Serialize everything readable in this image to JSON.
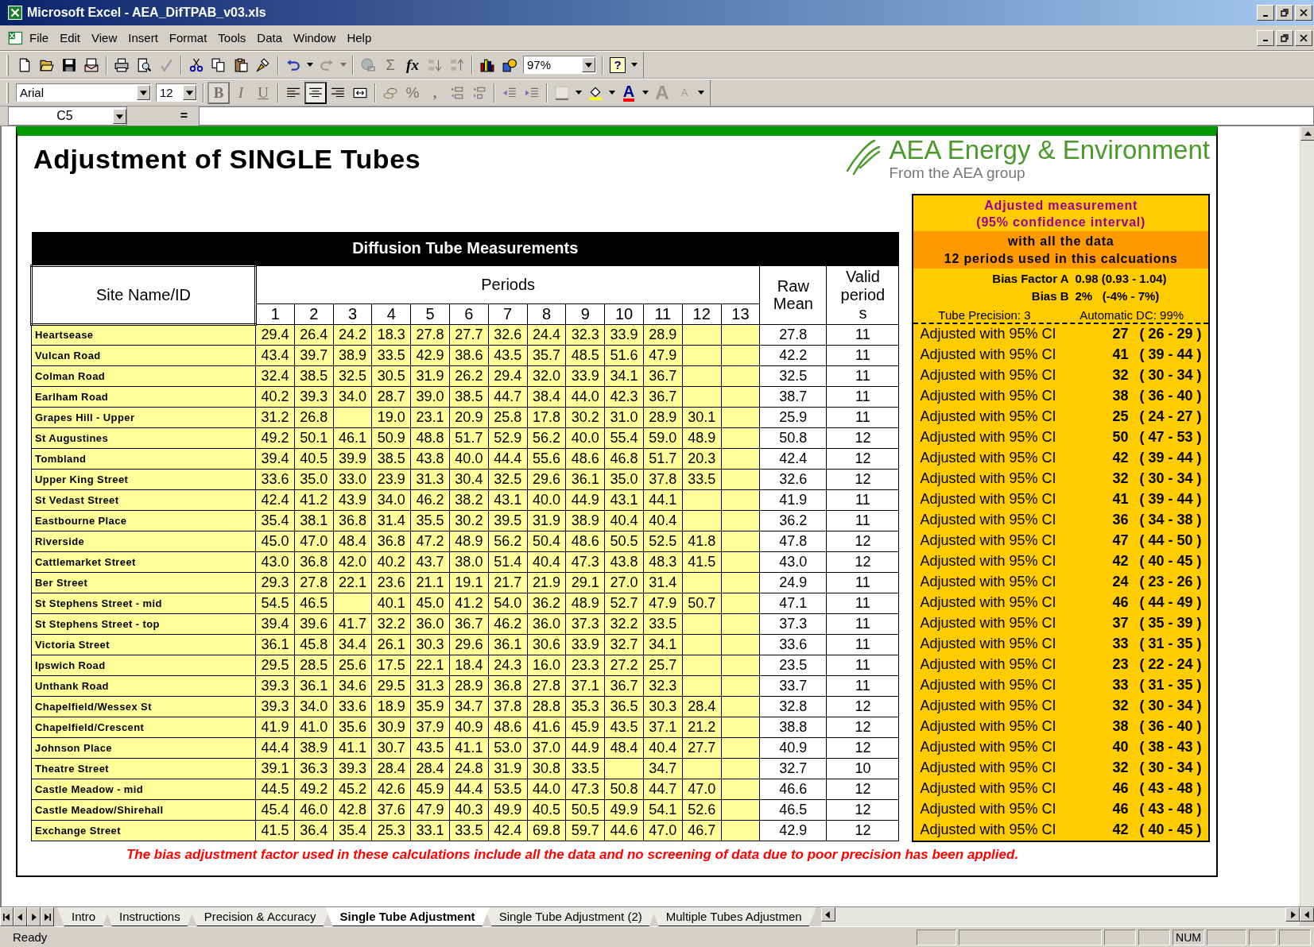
{
  "window": {
    "title": "Microsoft Excel - AEA_DifTPAB_v03.xls"
  },
  "menu": [
    "File",
    "Edit",
    "View",
    "Insert",
    "Format",
    "Tools",
    "Data",
    "Window",
    "Help"
  ],
  "standard_toolbar": [
    {
      "kind": "new",
      "disabled": false
    },
    {
      "kind": "open",
      "disabled": false
    },
    {
      "kind": "save",
      "disabled": false
    },
    {
      "kind": "mail",
      "disabled": false
    },
    {
      "kind": "separator"
    },
    {
      "kind": "print",
      "disabled": false
    },
    {
      "kind": "preview",
      "disabled": false
    },
    {
      "kind": "spelling",
      "disabled": true
    },
    {
      "kind": "separator"
    },
    {
      "kind": "cut",
      "disabled": false
    },
    {
      "kind": "copy",
      "disabled": false
    },
    {
      "kind": "paste",
      "disabled": false
    },
    {
      "kind": "painter",
      "disabled": false
    },
    {
      "kind": "separator"
    },
    {
      "kind": "undo",
      "disabled": false
    },
    {
      "kind": "caret",
      "disabled": false
    },
    {
      "kind": "redo",
      "disabled": true
    },
    {
      "kind": "caret",
      "disabled": true
    },
    {
      "kind": "separator"
    },
    {
      "kind": "hyperlink",
      "disabled": true
    },
    {
      "kind": "plainglyph",
      "text": "Σ",
      "disabled": true
    },
    {
      "kind": "scriptglyph",
      "text": "fx",
      "disabled": false
    },
    {
      "kind": "sortasc",
      "disabled": true
    },
    {
      "kind": "sortdesc",
      "disabled": true
    },
    {
      "kind": "separator"
    },
    {
      "kind": "chart",
      "disabled": false
    },
    {
      "kind": "drawing",
      "disabled": false
    },
    {
      "kind": "zoombox",
      "value": "97%"
    },
    {
      "kind": "separator"
    },
    {
      "kind": "helpglyph",
      "text": "?",
      "disabled": false
    },
    {
      "kind": "options",
      "disabled": false
    }
  ],
  "formatting_toolbar": [
    {
      "kind": "fontbox",
      "value": "Arial"
    },
    {
      "kind": "sizebox",
      "value": "12"
    },
    {
      "kind": "separator"
    },
    {
      "kind": "boldglyph",
      "text": "B",
      "disabled": true,
      "pressed": true
    },
    {
      "kind": "italicglyph",
      "text": "I",
      "disabled": true,
      "pressed": false
    },
    {
      "kind": "underlineglyph",
      "text": "U",
      "disabled": true,
      "pressed": false
    },
    {
      "kind": "separator"
    },
    {
      "kind": "alignleft",
      "disabled": false,
      "pressed": false
    },
    {
      "kind": "aligncenter",
      "disabled": false,
      "pressed": true
    },
    {
      "kind": "alignright",
      "disabled": false,
      "pressed": false
    },
    {
      "kind": "merge",
      "disabled": false,
      "pressed": false
    },
    {
      "kind": "separator"
    },
    {
      "kind": "currency",
      "disabled": true,
      "pressed": false
    },
    {
      "kind": "plainglyph",
      "text": "%",
      "disabled": true,
      "pressed": false
    },
    {
      "kind": "boldglyph",
      "text": ",",
      "disabled": true,
      "pressed": false
    },
    {
      "kind": "incdecimal",
      "disabled": true,
      "pressed": false
    },
    {
      "kind": "decdecimal",
      "disabled": true,
      "pressed": false
    },
    {
      "kind": "separator"
    },
    {
      "kind": "outdent",
      "disabled": true,
      "pressed": false
    },
    {
      "kind": "indent",
      "disabled": true,
      "pressed": false
    },
    {
      "kind": "separator"
    },
    {
      "kind": "borders",
      "disabled": true,
      "pressed": false
    },
    {
      "kind": "caret",
      "disabled": false,
      "pressed": false
    },
    {
      "kind": "fill",
      "disabled": false,
      "pressed": false
    },
    {
      "kind": "caret",
      "disabled": false,
      "pressed": false
    },
    {
      "kind": "colorglyph",
      "text": "A",
      "disabled": false,
      "pressed": false
    },
    {
      "kind": "caret",
      "disabled": false,
      "pressed": false
    },
    {
      "kind": "growglyph",
      "text": "A",
      "disabled": true,
      "pressed": false
    },
    {
      "kind": "shrinkglyph",
      "text": "A",
      "disabled": true,
      "pressed": false
    },
    {
      "kind": "options",
      "disabled": false,
      "pressed": false
    }
  ],
  "formula_bar": {
    "name_box": "C5",
    "equals": "="
  },
  "sheet": {
    "title": "Adjustment of SINGLE Tubes",
    "logo": {
      "name": "AEA Energy & Environment",
      "tagline": "From the AEA group"
    },
    "table": {
      "caption": "Diffusion Tube Measurements",
      "columns": {
        "site": "Site Name/ID",
        "periods": "Periods",
        "raw_mean": "Raw Mean",
        "valid_periods": "Valid periods"
      },
      "period_numbers": [
        "1",
        "2",
        "3",
        "4",
        "5",
        "6",
        "7",
        "8",
        "9",
        "10",
        "11",
        "12",
        "13"
      ],
      "rows": [
        {
          "site": "Heartsease",
          "values": {
            "p1": "29.4",
            "p2": "26.4",
            "p3": "24.2",
            "p4": "18.3",
            "p5": "27.8",
            "p6": "27.7",
            "p7": "32.6",
            "p8": "24.4",
            "p9": "32.3",
            "p10": "33.9",
            "p11": "28.9"
          },
          "raw_mean": "27.8",
          "valid": "11",
          "adjusted": {
            "label": "Adjusted with 95% CI",
            "value": "27",
            "interval": "( 26 - 29 )"
          }
        },
        {
          "site": "Vulcan Road",
          "values": {
            "p1": "43.4",
            "p2": "39.7",
            "p3": "38.9",
            "p4": "33.5",
            "p5": "42.9",
            "p6": "38.6",
            "p7": "43.5",
            "p8": "35.7",
            "p9": "48.5",
            "p10": "51.6",
            "p11": "47.9"
          },
          "raw_mean": "42.2",
          "valid": "11",
          "adjusted": {
            "label": "Adjusted with 95% CI",
            "value": "41",
            "interval": "( 39 - 44 )"
          }
        },
        {
          "site": "Colman Road",
          "values": {
            "p1": "32.4",
            "p2": "38.5",
            "p3": "32.5",
            "p4": "30.5",
            "p5": "31.9",
            "p6": "26.2",
            "p7": "29.4",
            "p8": "32.0",
            "p9": "33.9",
            "p10": "34.1",
            "p11": "36.7"
          },
          "raw_mean": "32.5",
          "valid": "11",
          "adjusted": {
            "label": "Adjusted with 95% CI",
            "value": "32",
            "interval": "( 30 - 34 )"
          }
        },
        {
          "site": "Earlham Road",
          "values": {
            "p1": "40.2",
            "p2": "39.3",
            "p3": "34.0",
            "p4": "28.7",
            "p5": "39.0",
            "p6": "38.5",
            "p7": "44.7",
            "p8": "38.4",
            "p9": "44.0",
            "p10": "42.3",
            "p11": "36.7"
          },
          "raw_mean": "38.7",
          "valid": "11",
          "adjusted": {
            "label": "Adjusted with 95% CI",
            "value": "38",
            "interval": "( 36 - 40 )"
          }
        },
        {
          "site": "Grapes Hill - Upper",
          "values": {
            "p1": "31.2",
            "p2": "26.8",
            "p4": "19.0",
            "p5": "23.1",
            "p6": "20.9",
            "p7": "25.8",
            "p8": "17.8",
            "p9": "30.2",
            "p10": "31.0",
            "p11": "28.9",
            "p12": "30.1"
          },
          "raw_mean": "25.9",
          "valid": "11",
          "adjusted": {
            "label": "Adjusted with 95% CI",
            "value": "25",
            "interval": "( 24 - 27 )"
          }
        },
        {
          "site": "St Augustines",
          "values": {
            "p1": "49.2",
            "p2": "50.1",
            "p3": "46.1",
            "p4": "50.9",
            "p5": "48.8",
            "p6": "51.7",
            "p7": "52.9",
            "p8": "56.2",
            "p9": "40.0",
            "p10": "55.4",
            "p11": "59.0",
            "p12": "48.9"
          },
          "raw_mean": "50.8",
          "valid": "12",
          "adjusted": {
            "label": "Adjusted with 95% CI",
            "value": "50",
            "interval": "( 47 - 53 )"
          }
        },
        {
          "site": "Tombland",
          "values": {
            "p1": "39.4",
            "p2": "40.5",
            "p3": "39.9",
            "p4": "38.5",
            "p5": "43.8",
            "p6": "40.0",
            "p7": "44.4",
            "p8": "55.6",
            "p9": "48.6",
            "p10": "46.8",
            "p11": "51.7",
            "p12": "20.3"
          },
          "raw_mean": "42.4",
          "valid": "12",
          "adjusted": {
            "label": "Adjusted with 95% CI",
            "value": "42",
            "interval": "( 39 - 44 )"
          }
        },
        {
          "site": "Upper King Street",
          "values": {
            "p1": "33.6",
            "p2": "35.0",
            "p3": "33.0",
            "p4": "23.9",
            "p5": "31.3",
            "p6": "30.4",
            "p7": "32.5",
            "p8": "29.6",
            "p9": "36.1",
            "p10": "35.0",
            "p11": "37.8",
            "p12": "33.5"
          },
          "raw_mean": "32.6",
          "valid": "12",
          "adjusted": {
            "label": "Adjusted with 95% CI",
            "value": "32",
            "interval": "( 30 - 34 )"
          }
        },
        {
          "site": "St Vedast Street",
          "values": {
            "p1": "42.4",
            "p2": "41.2",
            "p3": "43.9",
            "p4": "34.0",
            "p5": "46.2",
            "p6": "38.2",
            "p7": "43.1",
            "p8": "40.0",
            "p9": "44.9",
            "p10": "43.1",
            "p11": "44.1"
          },
          "raw_mean": "41.9",
          "valid": "11",
          "adjusted": {
            "label": "Adjusted with 95% CI",
            "value": "41",
            "interval": "( 39 - 44 )"
          }
        },
        {
          "site": "Eastbourne Place",
          "values": {
            "p1": "35.4",
            "p2": "38.1",
            "p3": "36.8",
            "p4": "31.4",
            "p5": "35.5",
            "p6": "30.2",
            "p7": "39.5",
            "p8": "31.9",
            "p9": "38.9",
            "p10": "40.4",
            "p11": "40.4"
          },
          "raw_mean": "36.2",
          "valid": "11",
          "adjusted": {
            "label": "Adjusted with 95% CI",
            "value": "36",
            "interval": "( 34 - 38 )"
          }
        },
        {
          "site": "Riverside",
          "values": {
            "p1": "45.0",
            "p2": "47.0",
            "p3": "48.4",
            "p4": "36.8",
            "p5": "47.2",
            "p6": "48.9",
            "p7": "56.2",
            "p8": "50.4",
            "p9": "48.6",
            "p10": "50.5",
            "p11": "52.5",
            "p12": "41.8"
          },
          "raw_mean": "47.8",
          "valid": "12",
          "adjusted": {
            "label": "Adjusted with 95% CI",
            "value": "47",
            "interval": "( 44 - 50 )"
          }
        },
        {
          "site": "Cattlemarket Street",
          "values": {
            "p1": "43.0",
            "p2": "36.8",
            "p3": "42.0",
            "p4": "40.2",
            "p5": "43.7",
            "p6": "38.0",
            "p7": "51.4",
            "p8": "40.4",
            "p9": "47.3",
            "p10": "43.8",
            "p11": "48.3",
            "p12": "41.5"
          },
          "raw_mean": "43.0",
          "valid": "12",
          "adjusted": {
            "label": "Adjusted with 95% CI",
            "value": "42",
            "interval": "( 40 - 45 )"
          }
        },
        {
          "site": "Ber Street",
          "values": {
            "p1": "29.3",
            "p2": "27.8",
            "p3": "22.1",
            "p4": "23.6",
            "p5": "21.1",
            "p6": "19.1",
            "p7": "21.7",
            "p8": "21.9",
            "p9": "29.1",
            "p10": "27.0",
            "p11": "31.4"
          },
          "raw_mean": "24.9",
          "valid": "11",
          "adjusted": {
            "label": "Adjusted with 95% CI",
            "value": "24",
            "interval": "( 23 - 26 )"
          }
        },
        {
          "site": "St Stephens Street - mid",
          "values": {
            "p1": "54.5",
            "p2": "46.5",
            "p4": "40.1",
            "p5": "45.0",
            "p6": "41.2",
            "p7": "54.0",
            "p8": "36.2",
            "p9": "48.9",
            "p10": "52.7",
            "p11": "47.9",
            "p12": "50.7"
          },
          "raw_mean": "47.1",
          "valid": "11",
          "adjusted": {
            "label": "Adjusted with 95% CI",
            "value": "46",
            "interval": "( 44 - 49 )"
          }
        },
        {
          "site": "St Stephens Street - top",
          "values": {
            "p1": "39.4",
            "p2": "39.6",
            "p3": "41.7",
            "p4": "32.2",
            "p5": "36.0",
            "p6": "36.7",
            "p7": "46.2",
            "p8": "36.0",
            "p9": "37.3",
            "p10": "32.2",
            "p11": "33.5"
          },
          "raw_mean": "37.3",
          "valid": "11",
          "adjusted": {
            "label": "Adjusted with 95% CI",
            "value": "37",
            "interval": "( 35 - 39 )"
          }
        },
        {
          "site": "Victoria Street",
          "values": {
            "p1": "36.1",
            "p2": "45.8",
            "p3": "34.4",
            "p4": "26.1",
            "p5": "30.3",
            "p6": "29.6",
            "p7": "36.1",
            "p8": "30.6",
            "p9": "33.9",
            "p10": "32.7",
            "p11": "34.1"
          },
          "raw_mean": "33.6",
          "valid": "11",
          "adjusted": {
            "label": "Adjusted with 95% CI",
            "value": "33",
            "interval": "( 31 - 35 )"
          }
        },
        {
          "site": "Ipswich Road",
          "values": {
            "p1": "29.5",
            "p2": "28.5",
            "p3": "25.6",
            "p4": "17.5",
            "p5": "22.1",
            "p6": "18.4",
            "p7": "24.3",
            "p8": "16.0",
            "p9": "23.3",
            "p10": "27.2",
            "p11": "25.7"
          },
          "raw_mean": "23.5",
          "valid": "11",
          "adjusted": {
            "label": "Adjusted with 95% CI",
            "value": "23",
            "interval": "( 22 - 24 )"
          }
        },
        {
          "site": "Unthank Road",
          "values": {
            "p1": "39.3",
            "p2": "36.1",
            "p3": "34.6",
            "p4": "29.5",
            "p5": "31.3",
            "p6": "28.9",
            "p7": "36.8",
            "p8": "27.8",
            "p9": "37.1",
            "p10": "36.7",
            "p11": "32.3"
          },
          "raw_mean": "33.7",
          "valid": "11",
          "adjusted": {
            "label": "Adjusted with 95% CI",
            "value": "33",
            "interval": "( 31 - 35 )"
          }
        },
        {
          "site": "Chapelfield/Wessex St",
          "values": {
            "p1": "39.3",
            "p2": "34.0",
            "p3": "33.6",
            "p4": "18.9",
            "p5": "35.9",
            "p6": "34.7",
            "p7": "37.8",
            "p8": "28.8",
            "p9": "35.3",
            "p10": "36.5",
            "p11": "30.3",
            "p12": "28.4"
          },
          "raw_mean": "32.8",
          "valid": "12",
          "adjusted": {
            "label": "Adjusted with 95% CI",
            "value": "32",
            "interval": "( 30 - 34 )"
          }
        },
        {
          "site": "Chapelfield/Crescent",
          "values": {
            "p1": "41.9",
            "p2": "41.0",
            "p3": "35.6",
            "p4": "30.9",
            "p5": "37.9",
            "p6": "40.9",
            "p7": "48.6",
            "p8": "41.6",
            "p9": "45.9",
            "p10": "43.5",
            "p11": "37.1",
            "p12": "21.2"
          },
          "raw_mean": "38.8",
          "valid": "12",
          "adjusted": {
            "label": "Adjusted with 95% CI",
            "value": "38",
            "interval": "( 36 - 40 )"
          }
        },
        {
          "site": "Johnson Place",
          "values": {
            "p1": "44.4",
            "p2": "38.9",
            "p3": "41.1",
            "p4": "30.7",
            "p5": "43.5",
            "p6": "41.1",
            "p7": "53.0",
            "p8": "37.0",
            "p9": "44.9",
            "p10": "48.4",
            "p11": "40.4",
            "p12": "27.7"
          },
          "raw_mean": "40.9",
          "valid": "12",
          "adjusted": {
            "label": "Adjusted with 95% CI",
            "value": "40",
            "interval": "( 38 - 43 )"
          }
        },
        {
          "site": "Theatre Street",
          "values": {
            "p1": "39.1",
            "p2": "36.3",
            "p3": "39.3",
            "p4": "28.4",
            "p5": "28.4",
            "p6": "24.8",
            "p7": "31.9",
            "p8": "30.8",
            "p9": "33.5",
            "p11": "34.7"
          },
          "raw_mean": "32.7",
          "valid": "10",
          "adjusted": {
            "label": "Adjusted with 95% CI",
            "value": "32",
            "interval": "( 30 - 34 )"
          }
        },
        {
          "site": "Castle Meadow - mid",
          "values": {
            "p1": "44.5",
            "p2": "49.2",
            "p3": "45.2",
            "p4": "42.6",
            "p5": "45.9",
            "p6": "44.4",
            "p7": "53.5",
            "p8": "44.0",
            "p9": "47.3",
            "p10": "50.8",
            "p11": "44.7",
            "p12": "47.0"
          },
          "raw_mean": "46.6",
          "valid": "12",
          "adjusted": {
            "label": "Adjusted with 95% CI",
            "value": "46",
            "interval": "( 43 - 48 )"
          }
        },
        {
          "site": "Castle Meadow/Shirehall",
          "values": {
            "p1": "45.4",
            "p2": "46.0",
            "p3": "42.8",
            "p4": "37.6",
            "p5": "47.9",
            "p6": "40.3",
            "p7": "49.9",
            "p8": "40.5",
            "p9": "50.5",
            "p10": "49.9",
            "p11": "54.1",
            "p12": "52.6"
          },
          "raw_mean": "46.5",
          "valid": "12",
          "adjusted": {
            "label": "Adjusted with 95% CI",
            "value": "46",
            "interval": "( 43 - 48 )"
          }
        },
        {
          "site": "Exchange Street",
          "values": {
            "p1": "41.5",
            "p2": "36.4",
            "p3": "35.4",
            "p4": "25.3",
            "p5": "33.1",
            "p6": "33.5",
            "p7": "42.4",
            "p8": "69.8",
            "p9": "59.7",
            "p10": "44.6",
            "p11": "47.0",
            "p12": "46.7"
          },
          "raw_mean": "42.9",
          "valid": "12",
          "adjusted": {
            "label": "Adjusted with 95% CI",
            "value": "42",
            "interval": "( 40 - 45 )"
          }
        }
      ]
    },
    "panel": {
      "title_lines": [
        "Adjusted measurement",
        "(95% confidence interval)"
      ],
      "subtitle_lines": [
        "with all the data",
        "12 periods used in this calcuations"
      ],
      "bias": [
        {
          "label": "Bias Factor A",
          "value": "0.98 (0.93 - 1.04)"
        },
        {
          "label": "Bias B",
          "value": "2%   (-4% - 7%)"
        }
      ],
      "precision": "Tube Precision: 3",
      "dc": "Automatic DC: 99%"
    },
    "footnote": "The bias adjustment factor used in these calculations include all the data and no screening of data due to poor precision has been applied."
  },
  "sheet_tabs": [
    {
      "label": "Intro",
      "selected": false
    },
    {
      "label": "Instructions",
      "selected": false
    },
    {
      "label": "Precision & Accuracy",
      "selected": false
    },
    {
      "label": "Single Tube Adjustment",
      "selected": true
    },
    {
      "label": "Single Tube Adjustment (2)",
      "selected": false
    },
    {
      "label": "Multiple Tubes Adjustmen",
      "selected": false
    }
  ],
  "status_bar": {
    "message": "Ready",
    "indicator": "NUM"
  }
}
